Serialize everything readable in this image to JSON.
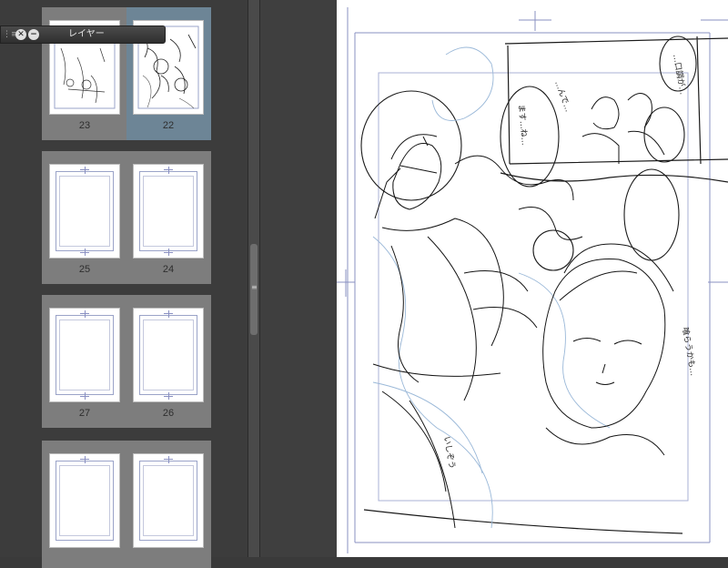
{
  "layer_panel": {
    "title": "レイヤー",
    "close_icon": "close-icon",
    "minimize_icon": "minimize-icon"
  },
  "page_thumbnails": {
    "spreads": [
      {
        "left": {
          "number": "23"
        },
        "right": {
          "number": "22",
          "selected": true
        }
      },
      {
        "left": {
          "number": "25"
        },
        "right": {
          "number": "24"
        }
      },
      {
        "left": {
          "number": "27"
        },
        "right": {
          "number": "26"
        }
      },
      {
        "left": {
          "number": ""
        },
        "right": {
          "number": ""
        }
      }
    ]
  },
  "colors": {
    "selection": "#6d8596",
    "panel_bg": "#3c3c3c",
    "spread_bg": "#7d7d7d",
    "guide_blue": "#8a90c2",
    "sketch_ink": "#1a1a1a",
    "sketch_blue": "#9ab8d8"
  },
  "canvas": {
    "sketch_texts": {
      "bubble_top_right": "…口調が…",
      "bubble_mid": "…んで…",
      "bubble_center": "ます…ね…",
      "side_text": "喰らうかも…",
      "bottom_text": "いしぞう"
    }
  }
}
